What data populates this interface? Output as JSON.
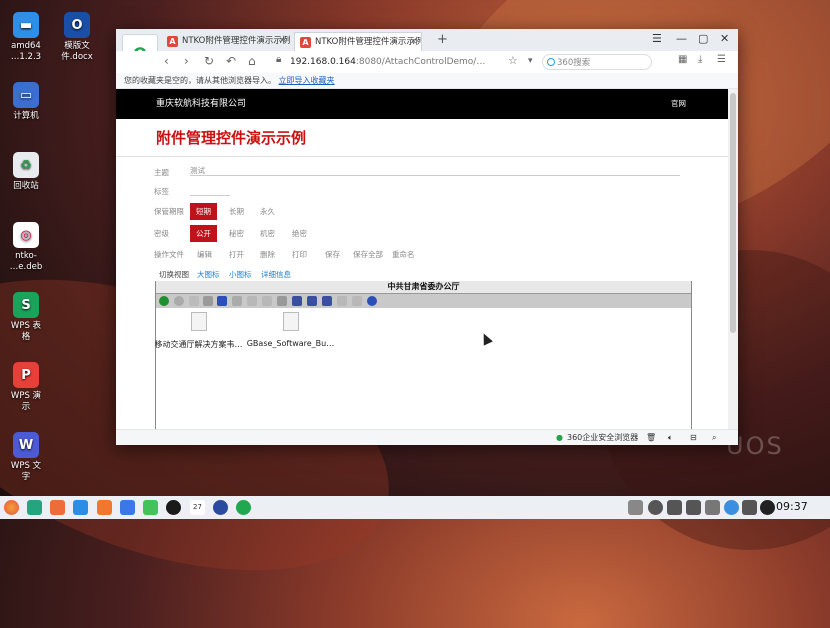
{
  "desktop": {
    "icons": [
      {
        "label": "amd64\n…1.2.3"
      },
      {
        "label": "模版文\n件.docx"
      },
      {
        "label": "计算机"
      },
      {
        "label": "回收站"
      },
      {
        "label": "ntko-\n…e.deb"
      },
      {
        "label": "WPS 表\n格"
      },
      {
        "label": "WPS 演\n示"
      },
      {
        "label": "WPS 文\n字"
      }
    ],
    "watermark": "UOS"
  },
  "browser": {
    "tabs": [
      {
        "label": "NTKO附件管理控件演示示例",
        "favicon": "A"
      },
      {
        "label": "NTKO附件管理控件演示示例",
        "favicon": "A"
      }
    ],
    "new_tab": "+",
    "url_host": "192.168.0.164",
    "url_path": ":8080/AttachControlDemo/…",
    "search_placeholder": "360搜索",
    "bookmark_text": "您的收藏夹是空的，请从其他浏览器导入。",
    "bookmark_link": "立即导入收藏夹",
    "status_text": "360企业安全浏览器"
  },
  "page": {
    "company": "重庆软航科技有限公司",
    "site_link": "官网",
    "title": "附件管理控件演示示例",
    "subject_label": "主题",
    "subject_value": "测试",
    "tags_label": "标签",
    "retention_label": "保管期限",
    "retention_options": [
      "短期",
      "长期",
      "永久"
    ],
    "secret_label": "密级",
    "secret_options": [
      "公开",
      "秘密",
      "机密",
      "绝密"
    ],
    "ops_label": "操作文件",
    "ops": [
      "编辑",
      "打开",
      "删除",
      "打印",
      "保存",
      "保存全部",
      "重命名"
    ],
    "view_label": "切换视图",
    "views": [
      "大图标",
      "小图标",
      "详细信息"
    ],
    "panel_title": "中共甘肃省委办公厅",
    "files": [
      "移动交通厅解决方案韦…",
      "GBase_Software_Bu…"
    ]
  },
  "taskbar": {
    "clock": "09:37",
    "date_badge": "27"
  },
  "colors": {
    "accent_red": "#c0121b",
    "link_blue": "#1a5fc0"
  }
}
